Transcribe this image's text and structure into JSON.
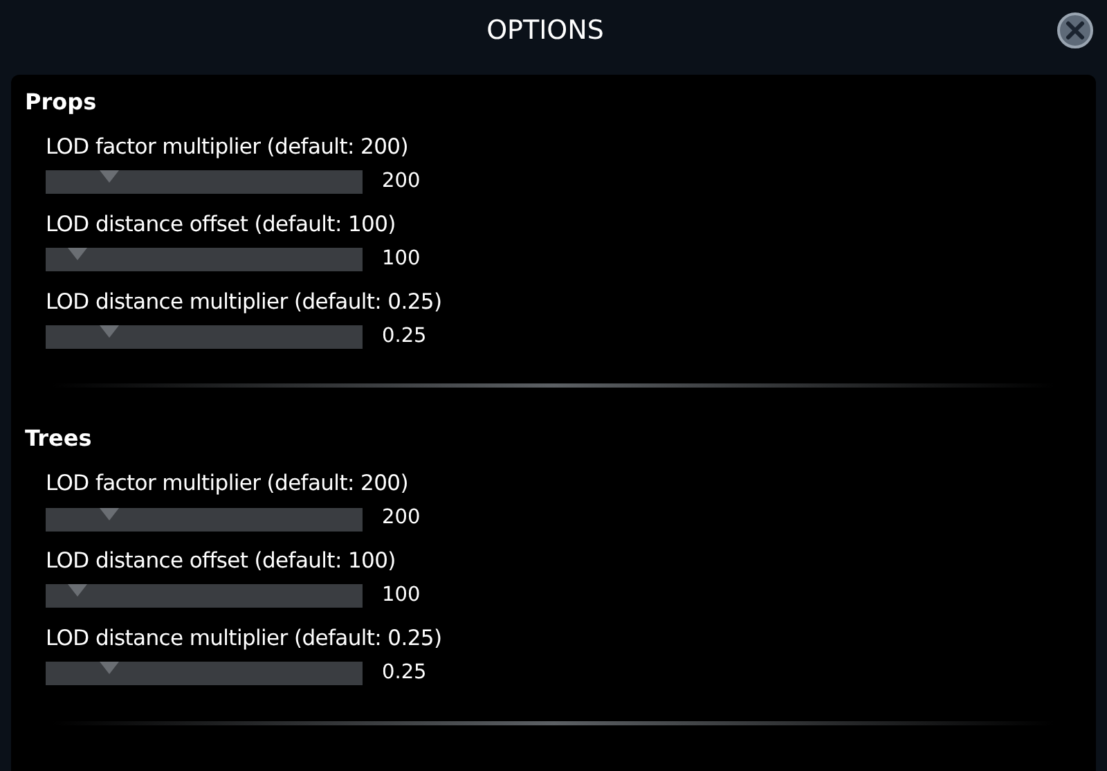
{
  "window": {
    "title": "OPTIONS"
  },
  "sections": [
    {
      "title": "Props",
      "sliders": [
        {
          "label": "LOD factor multiplier (default: 200)",
          "level": 0.2,
          "reading": "200"
        },
        {
          "label": "LOD distance offset (default: 100)",
          "level": 0.1,
          "reading": "100"
        },
        {
          "label": "LOD distance multiplier (default: 0.25)",
          "level": 0.2,
          "reading": "0.25"
        }
      ]
    },
    {
      "title": "Trees",
      "sliders": [
        {
          "label": "LOD factor multiplier (default: 200)",
          "level": 0.2,
          "reading": "200"
        },
        {
          "label": "LOD distance offset (default: 100)",
          "level": 0.1,
          "reading": "100"
        },
        {
          "label": "LOD distance multiplier (default: 0.25)",
          "level": 0.2,
          "reading": "0.25"
        }
      ]
    }
  ]
}
